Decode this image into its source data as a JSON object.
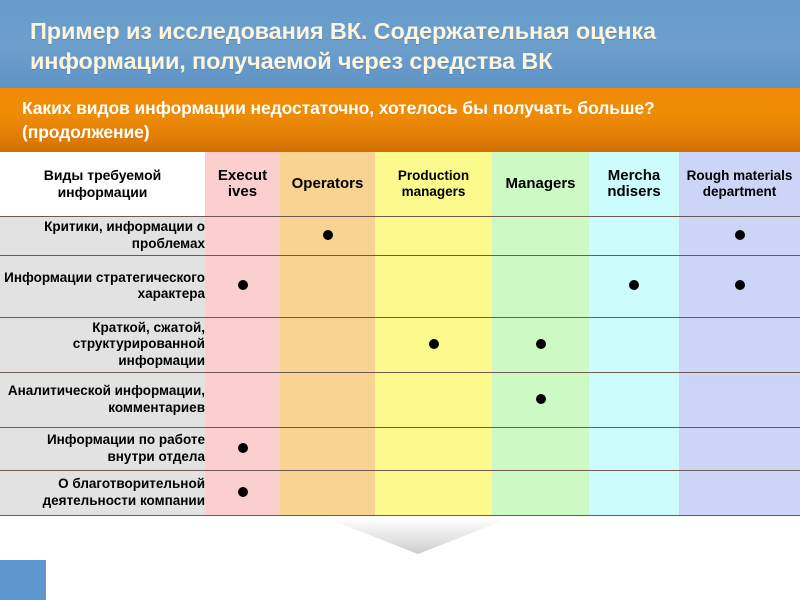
{
  "slide": {
    "title": "Пример из исследования ВК. Содержательная оценка информации, получаемой через средства ВК",
    "subtitle": "Каких видов информации недостаточно, хотелось бы получать больше? (продолжение)"
  },
  "colors": {
    "title_band": "#679cca",
    "subtitle_band": "#ef8c06",
    "title_text": "#fdf5e0",
    "subtitle_text": "#ffffff",
    "row_label_bg": "#e2e2e2",
    "col_executives": "#fccfcf",
    "col_operators": "#f8d391",
    "col_production_managers": "#fcfa8d",
    "col_managers": "#ccf9c4",
    "col_merchandisers": "#ccfcfc",
    "col_rough_materials": "#ccd4f7",
    "marker": "#000000",
    "corner_block": "#5e98ce"
  },
  "table": {
    "row_header_label": "Виды требуемой информации",
    "columns": [
      "Execut ives",
      "Operators",
      "Production managers",
      "Managers",
      "Mercha ndisers",
      "Rough materials department"
    ],
    "rows": [
      {
        "label": "Критики, информации о проблемах",
        "marks": [
          false,
          true,
          false,
          false,
          false,
          true
        ]
      },
      {
        "label": "Информации стратегического характера",
        "marks": [
          true,
          false,
          false,
          false,
          true,
          true
        ]
      },
      {
        "label": "Краткой, сжатой, структурированной информации",
        "marks": [
          false,
          false,
          true,
          true,
          false,
          false
        ]
      },
      {
        "label": "Аналитической информации, комментариев",
        "marks": [
          false,
          false,
          false,
          true,
          false,
          false
        ]
      },
      {
        "label": "Информации по работе внутри отдела",
        "marks": [
          true,
          false,
          false,
          false,
          false,
          false
        ]
      },
      {
        "label": "О благотворительной деятельности компании",
        "marks": [
          true,
          false,
          false,
          false,
          false,
          false
        ]
      }
    ],
    "marker_glyph": "●"
  }
}
